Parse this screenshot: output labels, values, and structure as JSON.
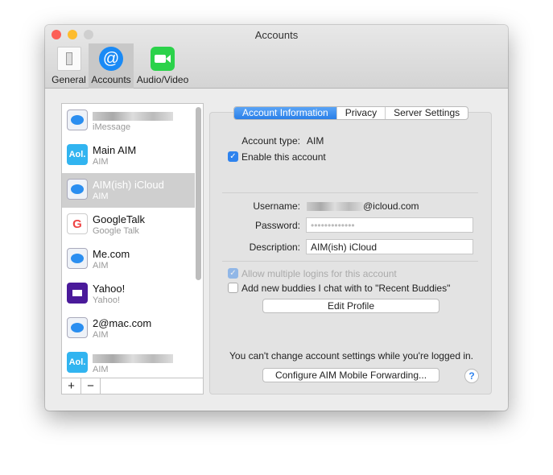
{
  "window": {
    "title": "Accounts"
  },
  "toolbar": [
    {
      "label": "General"
    },
    {
      "label": "Accounts"
    },
    {
      "label": "Audio/Video"
    }
  ],
  "accounts": [
    {
      "name": "",
      "type": "iMessage",
      "icon": "messages-icon"
    },
    {
      "name": "Main AIM",
      "type": "AIM",
      "icon": "aol-icon"
    },
    {
      "name": "AIM(ish) iCloud",
      "type": "AIM",
      "icon": "messages-icon",
      "selected": true
    },
    {
      "name": "GoogleTalk",
      "type": "Google Talk",
      "icon": "google-icon"
    },
    {
      "name": "Me.com",
      "type": "AIM",
      "icon": "messages-icon"
    },
    {
      "name": "Yahoo!",
      "type": "Yahoo!",
      "icon": "yahoo-icon"
    },
    {
      "name": "2@mac.com",
      "type": "AIM",
      "icon": "messages-icon"
    },
    {
      "name": "",
      "type": "AIM",
      "icon": "aol-icon"
    }
  ],
  "list_buttons": {
    "add": "+",
    "remove": "−"
  },
  "tabs": [
    "Account Information",
    "Privacy",
    "Server Settings"
  ],
  "form": {
    "account_type_label": "Account type:",
    "account_type": "AIM",
    "enable_label": "Enable this account",
    "username_label": "Username:",
    "username": "@icloud.com",
    "password_label": "Password:",
    "password": "•••••••••••••",
    "description_label": "Description:",
    "description": "AIM(ish) iCloud",
    "multiple_logins_label": "Allow multiple logins for this account",
    "recent_buddies_label": "Add new buddies I chat with to \"Recent Buddies\"",
    "edit_profile": "Edit Profile",
    "notice": "You can't change account settings while you're logged in.",
    "configure": "Configure AIM Mobile Forwarding...",
    "help": "?"
  }
}
